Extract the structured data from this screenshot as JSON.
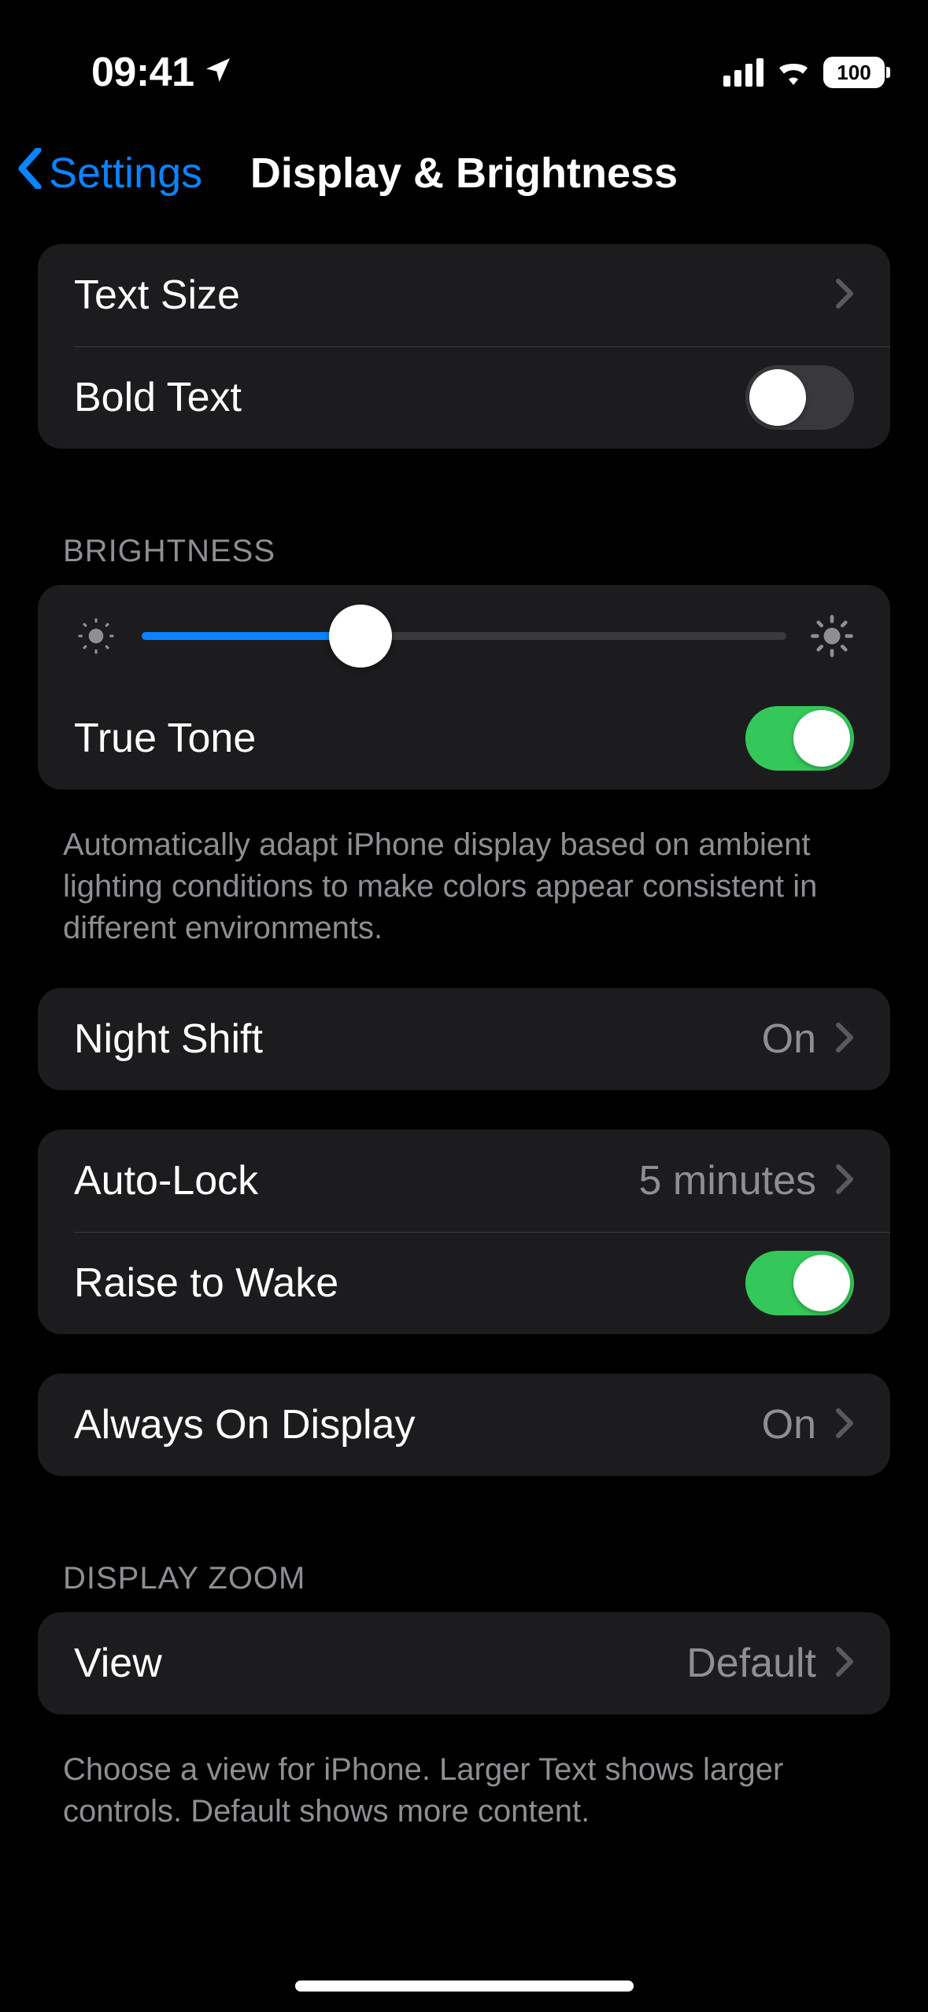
{
  "status": {
    "time": "09:41",
    "battery": "100"
  },
  "nav": {
    "back_label": "Settings",
    "title": "Display & Brightness"
  },
  "text_group": {
    "text_size": "Text Size",
    "bold_text": "Bold Text",
    "bold_text_on": false
  },
  "brightness": {
    "header": "Brightness",
    "slider_percent": 34,
    "true_tone_label": "True Tone",
    "true_tone_on": true,
    "footer": "Automatically adapt iPhone display based on ambient lighting conditions to make colors appear consistent in different environments."
  },
  "night_shift": {
    "label": "Night Shift",
    "value": "On"
  },
  "lock": {
    "auto_lock_label": "Auto-Lock",
    "auto_lock_value": "5 minutes",
    "raise_label": "Raise to Wake",
    "raise_on": true
  },
  "aod": {
    "label": "Always On Display",
    "value": "On"
  },
  "zoom": {
    "header": "Display Zoom",
    "view_label": "View",
    "view_value": "Default",
    "footer": "Choose a view for iPhone. Larger Text shows larger controls. Default shows more content."
  }
}
